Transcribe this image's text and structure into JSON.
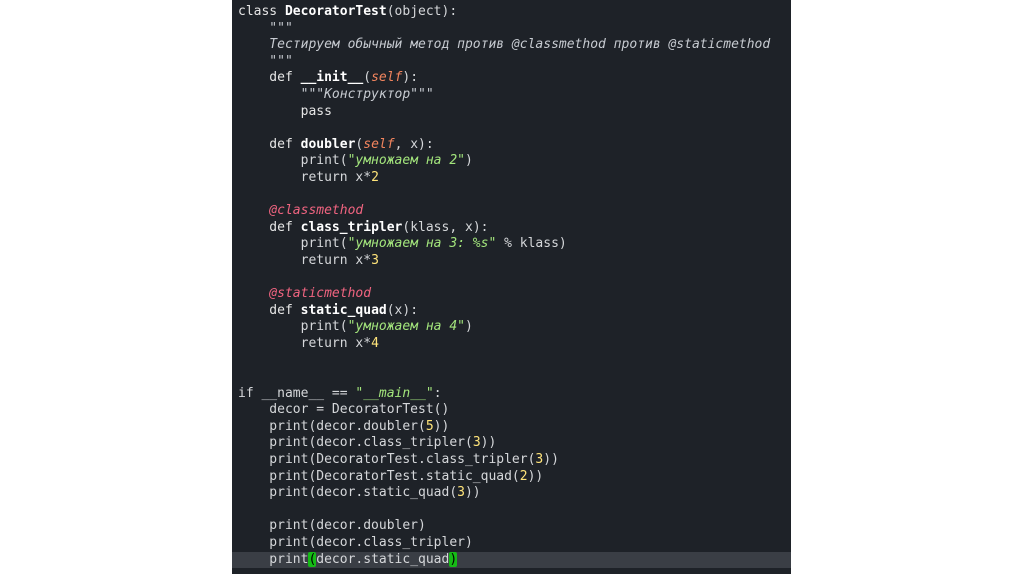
{
  "editor": {
    "lines": [
      {
        "tokens": [
          {
            "t": "class ",
            "c": "kw"
          },
          {
            "t": "DecoratorTest",
            "c": "fn"
          },
          {
            "t": "(object):",
            "c": ""
          }
        ]
      },
      {
        "tokens": [
          {
            "t": "    \"\"\"",
            "c": "doc"
          }
        ]
      },
      {
        "tokens": [
          {
            "t": "    Тестируем обычный метод против @classmethod против @staticmethod",
            "c": "doc"
          }
        ]
      },
      {
        "tokens": [
          {
            "t": "    \"\"\"",
            "c": "doc"
          }
        ]
      },
      {
        "tokens": [
          {
            "t": "    def ",
            "c": "kw"
          },
          {
            "t": "__init__",
            "c": "fn"
          },
          {
            "t": "(",
            "c": ""
          },
          {
            "t": "self",
            "c": "self"
          },
          {
            "t": "):",
            "c": ""
          }
        ]
      },
      {
        "tokens": [
          {
            "t": "        \"\"\"Конструктор\"\"\"",
            "c": "doc"
          }
        ]
      },
      {
        "tokens": [
          {
            "t": "        pass",
            "c": "kw"
          }
        ]
      },
      {
        "tokens": [
          {
            "t": "",
            "c": ""
          }
        ]
      },
      {
        "tokens": [
          {
            "t": "    def ",
            "c": "kw"
          },
          {
            "t": "doubler",
            "c": "fn"
          },
          {
            "t": "(",
            "c": ""
          },
          {
            "t": "self",
            "c": "self"
          },
          {
            "t": ", x):",
            "c": ""
          }
        ]
      },
      {
        "tokens": [
          {
            "t": "        print(",
            "c": ""
          },
          {
            "t": "\"умножаем на 2\"",
            "c": "str"
          },
          {
            "t": ")",
            "c": ""
          }
        ]
      },
      {
        "tokens": [
          {
            "t": "        return x*",
            "c": ""
          },
          {
            "t": "2",
            "c": "num"
          }
        ]
      },
      {
        "tokens": [
          {
            "t": "",
            "c": ""
          }
        ]
      },
      {
        "tokens": [
          {
            "t": "    @classmethod",
            "c": "dec"
          }
        ]
      },
      {
        "tokens": [
          {
            "t": "    def ",
            "c": "kw"
          },
          {
            "t": "class_tripler",
            "c": "fn"
          },
          {
            "t": "(klass, x):",
            "c": ""
          }
        ]
      },
      {
        "tokens": [
          {
            "t": "        print(",
            "c": ""
          },
          {
            "t": "\"умножаем на 3: %s\"",
            "c": "str"
          },
          {
            "t": " % klass)",
            "c": ""
          }
        ]
      },
      {
        "tokens": [
          {
            "t": "        return x*",
            "c": ""
          },
          {
            "t": "3",
            "c": "num"
          }
        ]
      },
      {
        "tokens": [
          {
            "t": "",
            "c": ""
          }
        ]
      },
      {
        "tokens": [
          {
            "t": "    @staticmethod",
            "c": "dec"
          }
        ]
      },
      {
        "tokens": [
          {
            "t": "    def ",
            "c": "kw"
          },
          {
            "t": "static_quad",
            "c": "fn"
          },
          {
            "t": "(x):",
            "c": ""
          }
        ]
      },
      {
        "tokens": [
          {
            "t": "        print(",
            "c": ""
          },
          {
            "t": "\"умножаем на 4\"",
            "c": "str"
          },
          {
            "t": ")",
            "c": ""
          }
        ]
      },
      {
        "tokens": [
          {
            "t": "        return x*",
            "c": ""
          },
          {
            "t": "4",
            "c": "num"
          }
        ]
      },
      {
        "tokens": [
          {
            "t": "",
            "c": ""
          }
        ]
      },
      {
        "tokens": [
          {
            "t": "",
            "c": ""
          }
        ]
      },
      {
        "tokens": [
          {
            "t": "if __name__ == ",
            "c": ""
          },
          {
            "t": "\"__main__\"",
            "c": "str"
          },
          {
            "t": ":",
            "c": ""
          }
        ]
      },
      {
        "tokens": [
          {
            "t": "    decor = DecoratorTest()",
            "c": ""
          }
        ]
      },
      {
        "tokens": [
          {
            "t": "    print(decor.doubler(",
            "c": ""
          },
          {
            "t": "5",
            "c": "num"
          },
          {
            "t": "))",
            "c": ""
          }
        ]
      },
      {
        "tokens": [
          {
            "t": "    print(decor.class_tripler(",
            "c": ""
          },
          {
            "t": "3",
            "c": "num"
          },
          {
            "t": "))",
            "c": ""
          }
        ]
      },
      {
        "tokens": [
          {
            "t": "    print(DecoratorTest.class_tripler(",
            "c": ""
          },
          {
            "t": "3",
            "c": "num"
          },
          {
            "t": "))",
            "c": ""
          }
        ]
      },
      {
        "tokens": [
          {
            "t": "    print(DecoratorTest.static_quad(",
            "c": ""
          },
          {
            "t": "2",
            "c": "num"
          },
          {
            "t": "))",
            "c": ""
          }
        ]
      },
      {
        "tokens": [
          {
            "t": "    print(decor.static_quad(",
            "c": ""
          },
          {
            "t": "3",
            "c": "num"
          },
          {
            "t": "))",
            "c": ""
          }
        ]
      },
      {
        "tokens": [
          {
            "t": "",
            "c": ""
          }
        ]
      },
      {
        "tokens": [
          {
            "t": "    print(decor.doubler)",
            "c": ""
          }
        ]
      },
      {
        "tokens": [
          {
            "t": "    print(decor.class_tripler)",
            "c": ""
          }
        ]
      },
      {
        "tokens": [
          {
            "t": "    print",
            "c": ""
          },
          {
            "t": "(",
            "c": "brk-match"
          },
          {
            "t": "decor.static_quad",
            "c": ""
          },
          {
            "t": ")",
            "c": "brk-match"
          }
        ],
        "current": true
      }
    ]
  }
}
